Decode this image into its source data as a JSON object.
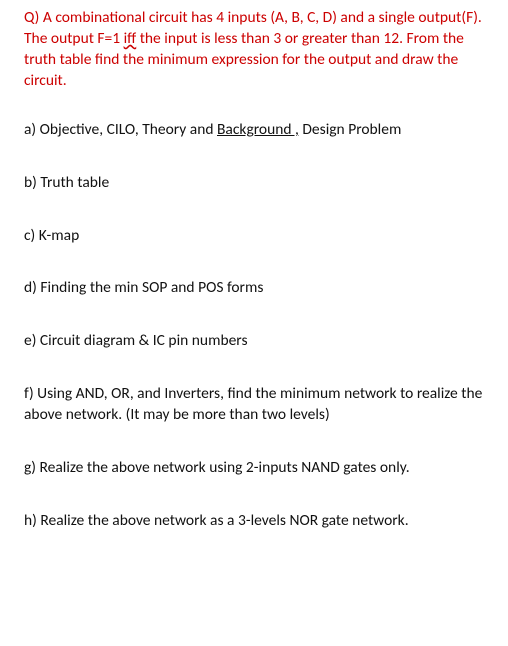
{
  "question": {
    "prefix": "Q) A combinational circuit has 4 inputs (A, B, C, D) and a single output(F). The output F=1 ",
    "iff_word": "iff",
    "suffix": " the input is less than 3 or greater than 12. From the truth table find the minimum expression for the output and draw the circuit."
  },
  "items": {
    "a_pre": "a) Objective, CILO, Theory and ",
    "a_under": "Background ,",
    "a_post": " Design Problem",
    "b": "b) Truth table",
    "c": "c) K-map",
    "d": "d) Finding the min SOP and POS forms",
    "e": "e) Circuit diagram & IC pin numbers",
    "f": "f) Using AND, OR, and Inverters, find the minimum network to realize the above network. (It may be more than two levels)",
    "g": "g) Realize the above network using 2-inputs NAND gates only.",
    "h": "h) Realize the above network as a 3-levels NOR gate network."
  }
}
